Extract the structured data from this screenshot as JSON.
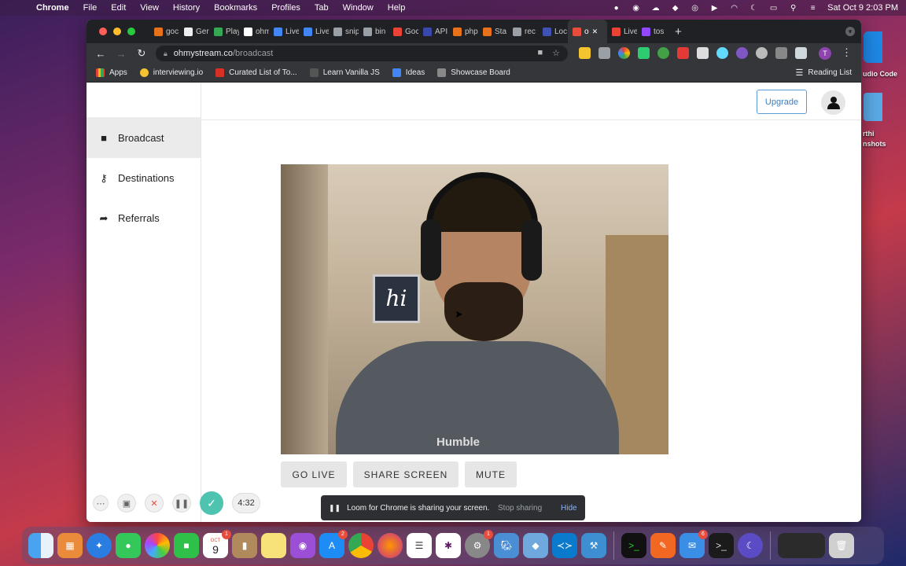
{
  "menubar": {
    "app_name": "Chrome",
    "items": [
      "File",
      "Edit",
      "View",
      "History",
      "Bookmarks",
      "Profiles",
      "Tab",
      "Window",
      "Help"
    ],
    "clock": "Sat Oct 9  2:03 PM"
  },
  "tabs": [
    {
      "label": "goc",
      "color": "#e8711c"
    },
    {
      "label": "Ger",
      "color": "#eeeeee"
    },
    {
      "label": "Play",
      "color": "#34a853"
    },
    {
      "label": "ohm",
      "color": "#ffffff"
    },
    {
      "label": "Live",
      "color": "#4285f4"
    },
    {
      "label": "Live",
      "color": "#4285f4"
    },
    {
      "label": "snip",
      "color": "#9aa0a6"
    },
    {
      "label": "bin",
      "color": "#9aa0a6"
    },
    {
      "label": "Goc",
      "color": "#ea4335"
    },
    {
      "label": "API",
      "color": "#3949ab"
    },
    {
      "label": "php",
      "color": "#e8711c"
    },
    {
      "label": "Sta",
      "color": "#e8711c"
    },
    {
      "label": "rec",
      "color": "#9aa0a6"
    },
    {
      "label": "Loc",
      "color": "#3f51b5"
    },
    {
      "label": "o",
      "color": "#e74c3c",
      "active": true
    },
    {
      "label": "Live",
      "color": "#ea4335"
    },
    {
      "label": "tos",
      "color": "#9146ff"
    }
  ],
  "address": {
    "host": "ohmystream.co",
    "path": "/broadcast"
  },
  "profile_initial": "T",
  "bookmarks": [
    {
      "label": "Apps",
      "color": "#e8eaed"
    },
    {
      "label": "interviewing.io",
      "color": "#f4c430"
    },
    {
      "label": "Curated List of To...",
      "color": "#d93025"
    },
    {
      "label": "Learn Vanilla JS",
      "color": "#555555"
    },
    {
      "label": "Ideas",
      "color": "#4285f4"
    },
    {
      "label": "Showcase Board",
      "color": "#888888"
    }
  ],
  "reading_list": "Reading List",
  "sidebar": {
    "items": [
      {
        "label": "Broadcast",
        "icon": "video-camera-icon",
        "active": true
      },
      {
        "label": "Destinations",
        "icon": "key-icon"
      },
      {
        "label": "Referrals",
        "icon": "share-arrow-icon"
      }
    ]
  },
  "header": {
    "upgrade_label": "Upgrade"
  },
  "video": {
    "frame_text": "hi",
    "shirt_text": "Humble"
  },
  "controls": {
    "go_live": "GO LIVE",
    "share_screen": "SHARE SCREEN",
    "mute": "MUTE"
  },
  "loom": {
    "timer": "4:32",
    "banner_text": "Loom for Chrome is sharing your screen.",
    "stop_label": "Stop sharing",
    "hide_label": "Hide"
  },
  "desktop": {
    "vscode_label": "udio Code",
    "screenshots_label_1": "rthi",
    "screenshots_label_2": "nshots"
  },
  "dock": {
    "calendar_day": "9",
    "calendar_month": "OCT",
    "badges": {
      "appstore": "2",
      "calendar": "1",
      "settings": "1",
      "mail": "6"
    }
  }
}
